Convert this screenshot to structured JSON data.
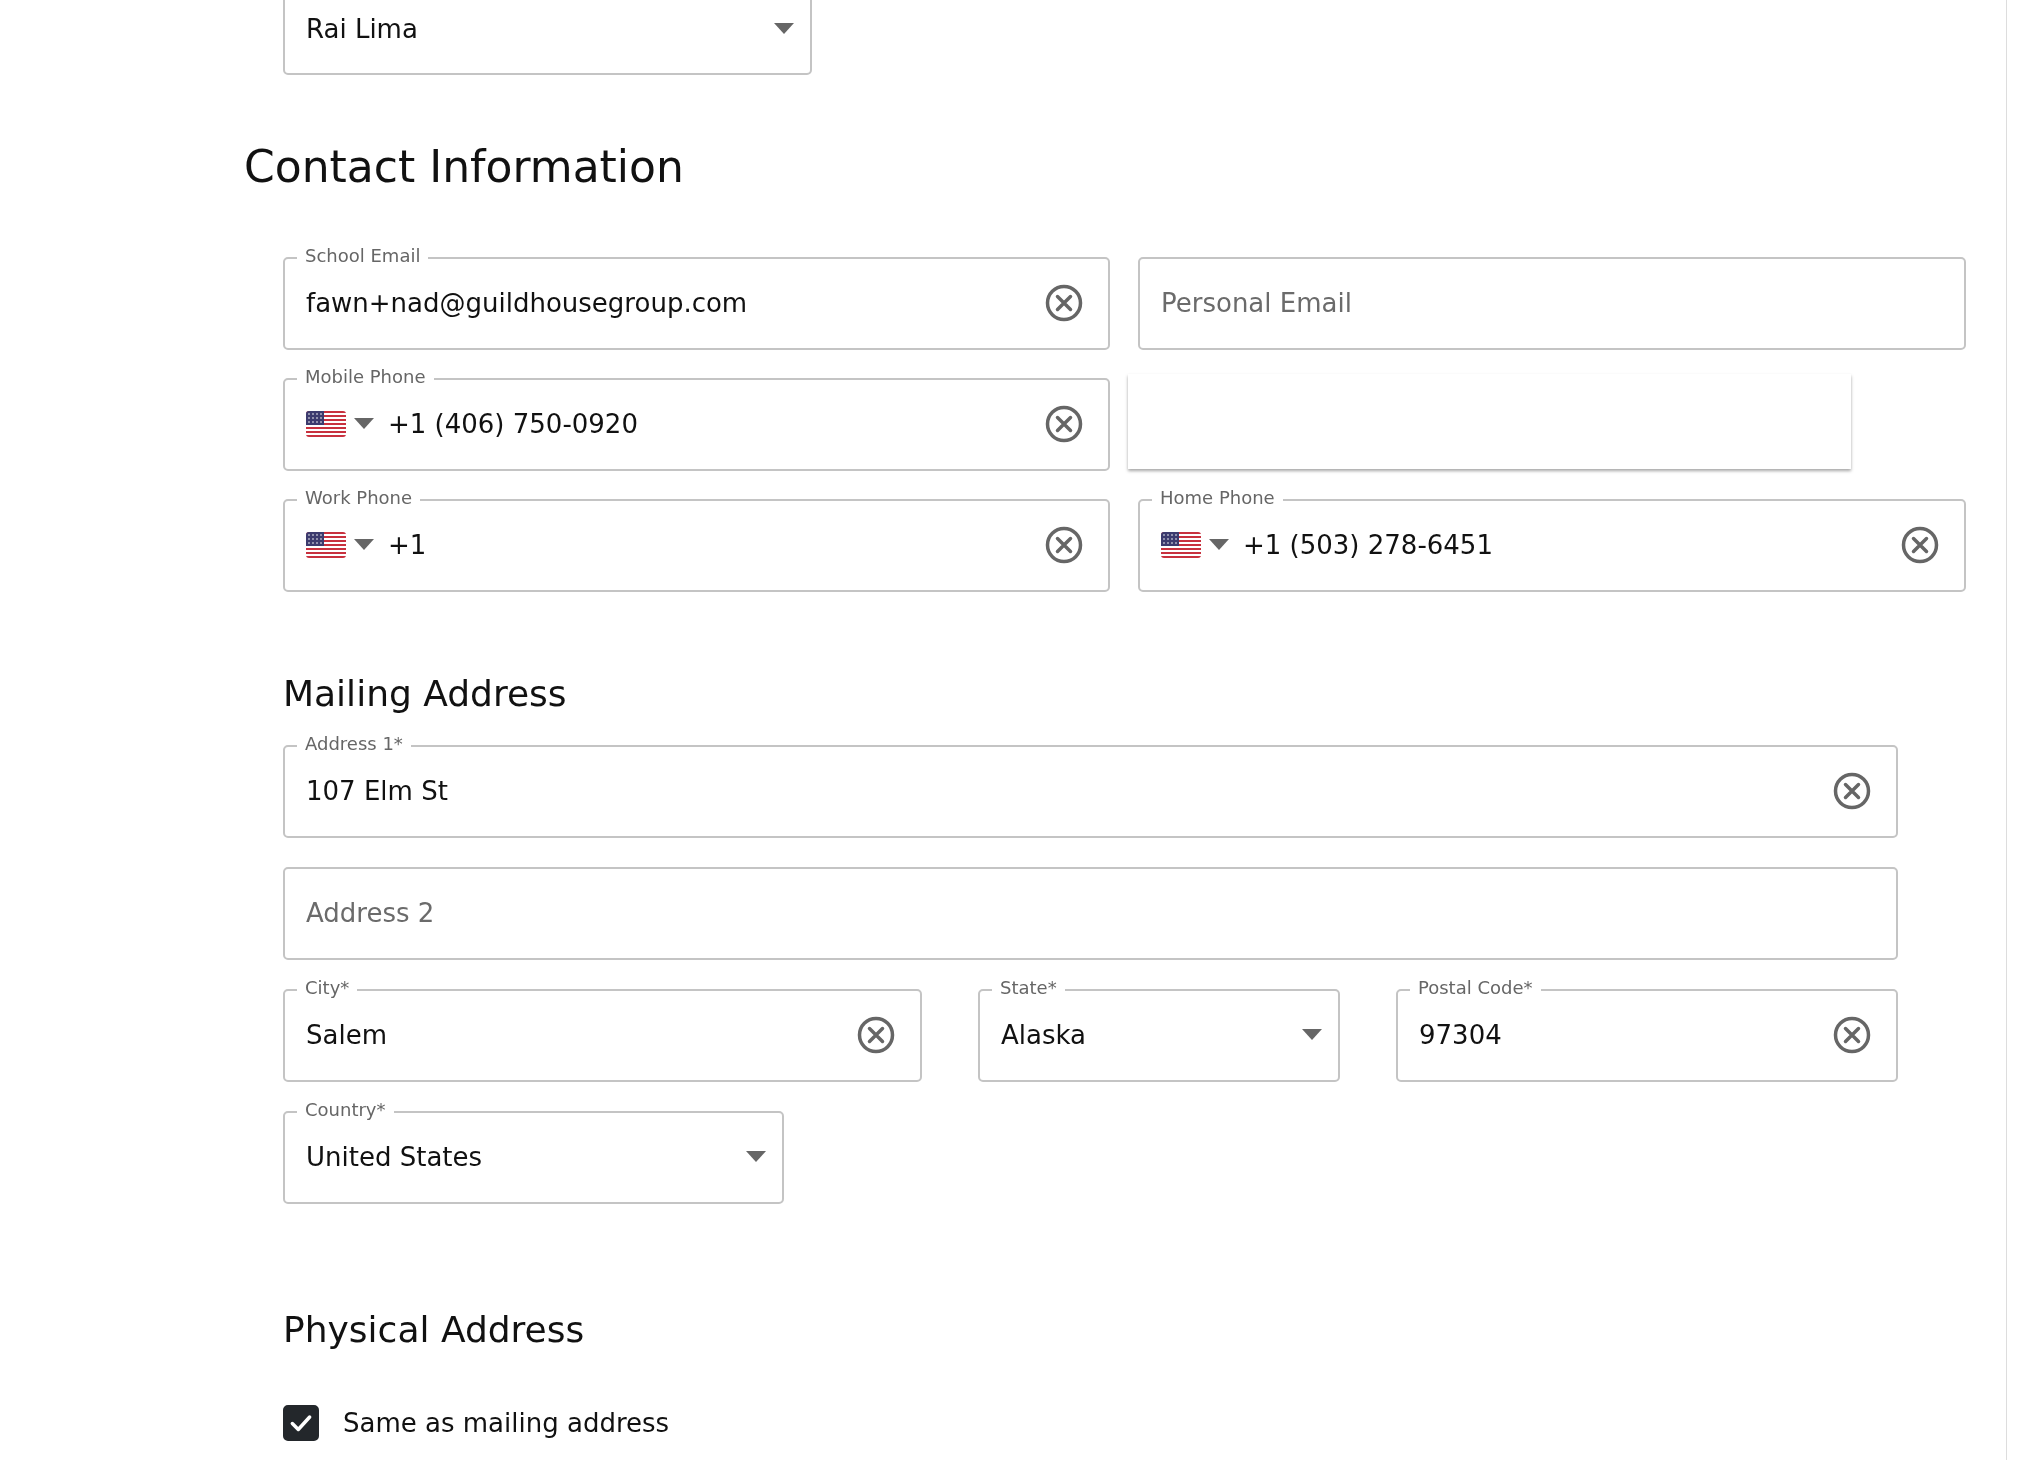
{
  "assignee_select": {
    "kind": "select",
    "value": "Rai Lima"
  },
  "contact_information": {
    "heading": "Contact Information",
    "rows": [
      [
        {
          "kind": "text",
          "label": "School Email",
          "value": "fawn+nad@guildhousegroup.com",
          "clearable": true
        },
        {
          "kind": "text",
          "placeholder": "Personal Email",
          "clearable": false
        }
      ],
      [
        {
          "kind": "phone",
          "label": "Mobile Phone",
          "value": "+1 (406) 750-0920",
          "clearable": true
        }
      ],
      [
        {
          "kind": "phone",
          "label": "Work Phone",
          "value": "+1",
          "clearable": true
        },
        {
          "kind": "phone",
          "label": "Home Phone",
          "value": "+1 (503) 278-6451",
          "clearable": true
        }
      ]
    ]
  },
  "mailing_address": {
    "heading": "Mailing Address",
    "rows": [
      [
        {
          "kind": "text",
          "label": "Address 1*",
          "value": "107 Elm St",
          "clearable": true
        }
      ],
      [
        {
          "kind": "text",
          "placeholder": "Address 2",
          "clearable": false
        }
      ],
      [
        {
          "kind": "text",
          "label": "City*",
          "value": "Salem",
          "clearable": true
        },
        {
          "kind": "select",
          "label": "State*",
          "value": "Alaska"
        },
        {
          "kind": "text",
          "label": "Postal Code*",
          "value": "97304",
          "clearable": true
        }
      ],
      [
        {
          "kind": "select",
          "label": "Country*",
          "value": "United States"
        }
      ]
    ]
  },
  "physical_address": {
    "heading": "Physical Address",
    "same_as_mailing": {
      "label": "Same as mailing address",
      "checked": true
    }
  }
}
